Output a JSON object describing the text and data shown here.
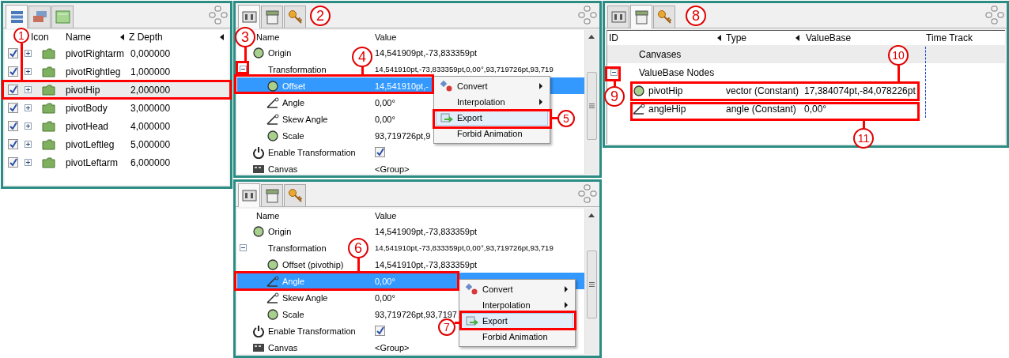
{
  "layers_panel": {
    "tabs": [
      {
        "kind": "layers",
        "selected": true
      },
      {
        "kind": "sets",
        "selected": false
      },
      {
        "kind": "canvas",
        "selected": false
      }
    ],
    "columns": [
      {
        "label": "Icon",
        "sort_arrow": false
      },
      {
        "label": "Name",
        "sort_arrow": true
      },
      {
        "label": "Z Depth",
        "sort_arrow": true
      }
    ],
    "rows": [
      {
        "name": "pivotRightarm",
        "z_depth": "0,000000",
        "visible": true,
        "expanded": false,
        "selected": false
      },
      {
        "name": "pivotRightleg",
        "z_depth": "1,000000",
        "visible": true,
        "expanded": false,
        "selected": false
      },
      {
        "name": "pivotHip",
        "z_depth": "2,000000",
        "visible": true,
        "expanded": false,
        "selected": true
      },
      {
        "name": "pivotBody",
        "z_depth": "3,000000",
        "visible": true,
        "expanded": false,
        "selected": false
      },
      {
        "name": "pivotHead",
        "z_depth": "4,000000",
        "visible": true,
        "expanded": false,
        "selected": false
      },
      {
        "name": "pivotLeftleg",
        "z_depth": "5,000000",
        "visible": true,
        "expanded": false,
        "selected": false
      },
      {
        "name": "pivotLeftarm",
        "z_depth": "6,000000",
        "visible": true,
        "expanded": false,
        "selected": false
      }
    ]
  },
  "params_panels": [
    {
      "tabs": [
        {
          "kind": "params",
          "selected": true
        },
        {
          "kind": "library",
          "selected": false
        },
        {
          "kind": "keyframes",
          "selected": false
        }
      ],
      "columns": [
        {
          "label": "Name"
        },
        {
          "label": "Value"
        }
      ],
      "rows": [
        {
          "kind": "vector",
          "name": "Origin",
          "value": "14,541909pt,-73,833359pt",
          "selected": false
        },
        {
          "kind": "composite",
          "name": "Transformation",
          "value": "14,541910pt,-73,833359pt,0,00°,93,719726pt,93,719",
          "expanded": true,
          "selected": false,
          "children": [
            {
              "kind": "vector",
              "name": "Offset",
              "value": "14,541910pt,-",
              "selected": true
            },
            {
              "kind": "angle",
              "name": "Angle",
              "value": "0,00°",
              "selected": false
            },
            {
              "kind": "angle",
              "name": "Skew Angle",
              "value": "0,00°",
              "selected": false
            },
            {
              "kind": "vector",
              "name": "Scale",
              "value": "93,719726pt,9",
              "selected": false
            }
          ]
        },
        {
          "kind": "bool",
          "name": "Enable Transformation",
          "checked": true,
          "selected": false
        },
        {
          "kind": "canvas",
          "name": "Canvas",
          "value": "<Group>",
          "selected": false
        }
      ],
      "context_menu": {
        "items": [
          {
            "kind": "convert",
            "label": "Convert",
            "submenu": true,
            "highlighted": false
          },
          {
            "kind": "plain",
            "label": "Interpolation",
            "submenu": true,
            "highlighted": false
          },
          {
            "kind": "export",
            "label": "Export",
            "submenu": false,
            "highlighted": true
          },
          {
            "kind": "plain",
            "label": "Forbid Animation",
            "submenu": false,
            "highlighted": false
          }
        ]
      }
    },
    {
      "tabs": [
        {
          "kind": "params",
          "selected": true
        },
        {
          "kind": "library",
          "selected": false
        },
        {
          "kind": "keyframes",
          "selected": false
        }
      ],
      "columns": [
        {
          "label": "Name"
        },
        {
          "label": "Value"
        }
      ],
      "rows": [
        {
          "kind": "vector",
          "name": "Origin",
          "value": "14,541909pt,-73,833359pt",
          "selected": false
        },
        {
          "kind": "composite",
          "name": "Transformation",
          "value": "14,541910pt,-73,833359pt,0,00°,93,719726pt,93,719",
          "expanded": true,
          "selected": false,
          "children": [
            {
              "kind": "vector",
              "name": "Offset (pivothip)",
              "value": "14,541910pt,-73,833359pt",
              "selected": false
            },
            {
              "kind": "angle",
              "name": "Angle",
              "value": "0,00°",
              "selected": true
            },
            {
              "kind": "angle",
              "name": "Skew Angle",
              "value": "0,00°",
              "selected": false
            },
            {
              "kind": "vector",
              "name": "Scale",
              "value": "93,719726pt,93,7197",
              "selected": false
            }
          ]
        },
        {
          "kind": "bool",
          "name": "Enable Transformation",
          "checked": true,
          "selected": false
        },
        {
          "kind": "canvas",
          "name": "Canvas",
          "value": "<Group>",
          "selected": false
        }
      ],
      "context_menu": {
        "items": [
          {
            "kind": "convert",
            "label": "Convert",
            "submenu": true,
            "highlighted": false
          },
          {
            "kind": "plain",
            "label": "Interpolation",
            "submenu": true,
            "highlighted": false
          },
          {
            "kind": "export",
            "label": "Export",
            "submenu": false,
            "highlighted": true
          },
          {
            "kind": "plain",
            "label": "Forbid Animation",
            "submenu": false,
            "highlighted": false
          }
        ]
      }
    }
  ],
  "library_panel": {
    "tabs": [
      {
        "kind": "params",
        "selected": false
      },
      {
        "kind": "library",
        "selected": true
      },
      {
        "kind": "keyframes",
        "selected": false
      }
    ],
    "columns": [
      {
        "label": "ID",
        "sort_arrow": true
      },
      {
        "label": "Type",
        "sort_arrow": true
      },
      {
        "label": "ValueBase",
        "sort_arrow": false
      },
      {
        "label": "Time Track",
        "sort_arrow": false
      }
    ],
    "rows": [
      {
        "kind": "group",
        "id": "Canvases"
      },
      {
        "kind": "group",
        "id": "ValueBase Nodes",
        "expanded": true,
        "children": [
          {
            "kind": "vector",
            "id": "pivotHip",
            "type": "vector (Constant)",
            "value": "17,384074pt,-84,078226pt"
          },
          {
            "kind": "angle",
            "id": "angleHip",
            "type": "angle (Constant)",
            "value": "0,00°"
          }
        ]
      }
    ]
  },
  "callouts": [
    {
      "number": "1"
    },
    {
      "number": "2"
    },
    {
      "number": "3"
    },
    {
      "number": "4"
    },
    {
      "number": "5"
    },
    {
      "number": "6"
    },
    {
      "number": "7"
    },
    {
      "number": "8"
    },
    {
      "number": "9"
    },
    {
      "number": "10"
    },
    {
      "number": "11"
    }
  ]
}
